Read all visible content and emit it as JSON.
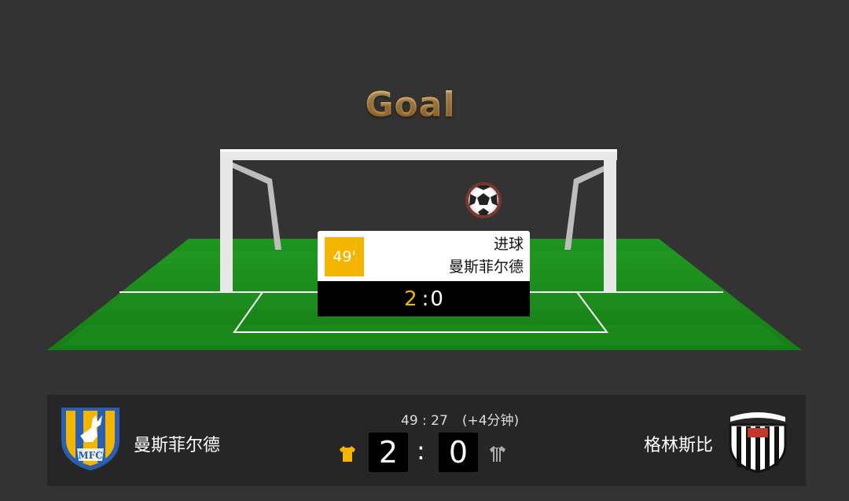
{
  "banner": {
    "title": "Goal"
  },
  "event": {
    "minute": "49'",
    "type": "进球",
    "team": "曼斯菲尔德",
    "score_home": "2",
    "score_sep": ":",
    "score_away": "0"
  },
  "match": {
    "clock": "49 : 27",
    "added_time": "(+4分钟)",
    "home_team": "曼斯菲尔德",
    "away_team": "格林斯比",
    "home_score": "2",
    "away_score": "0",
    "score_sep": ":"
  },
  "colors": {
    "background": "#333333",
    "pitch": "#1f8a1f",
    "accent_yellow": "#f3b500",
    "title_gold": "#e3a64a"
  },
  "icons": {
    "ball": "soccer-ball-icon",
    "home_shirt": "yellow-shirt-icon",
    "away_shirt": "striped-shirt-icon",
    "home_logo": "mansfield-crest-icon",
    "away_logo": "grimsby-crest-icon"
  }
}
